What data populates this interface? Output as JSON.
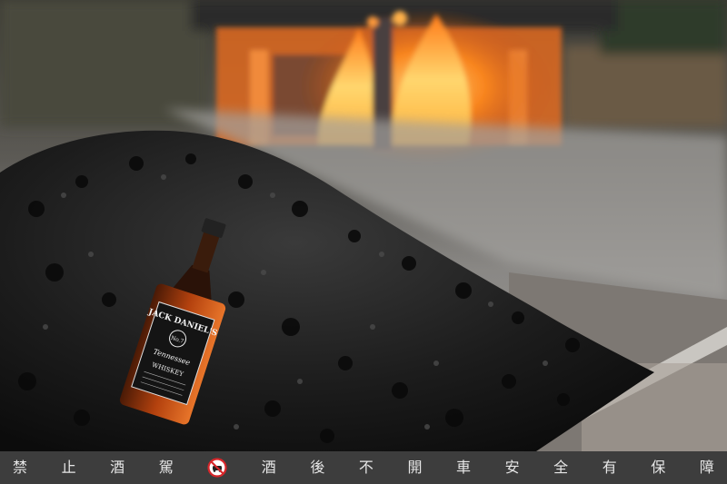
{
  "photo": {
    "description_icons": [
      "whiskey-bottle",
      "charcoal-pile",
      "fire-kiln"
    ],
    "bottle_label": {
      "brand": "JACK DANIEL'S",
      "number": "No.7",
      "line1": "Tennessee",
      "line2": "WHISKEY"
    }
  },
  "banner": {
    "chars": [
      "禁",
      "止",
      "酒",
      "駕",
      "酒",
      "後",
      "不",
      "開",
      "車",
      "安",
      "全",
      "有",
      "保",
      "障"
    ],
    "icon": "no-drunk-driving-icon",
    "colors": {
      "background": "#3d3d3d",
      "text": "#e6e6e6",
      "icon": "#d7262a"
    }
  }
}
